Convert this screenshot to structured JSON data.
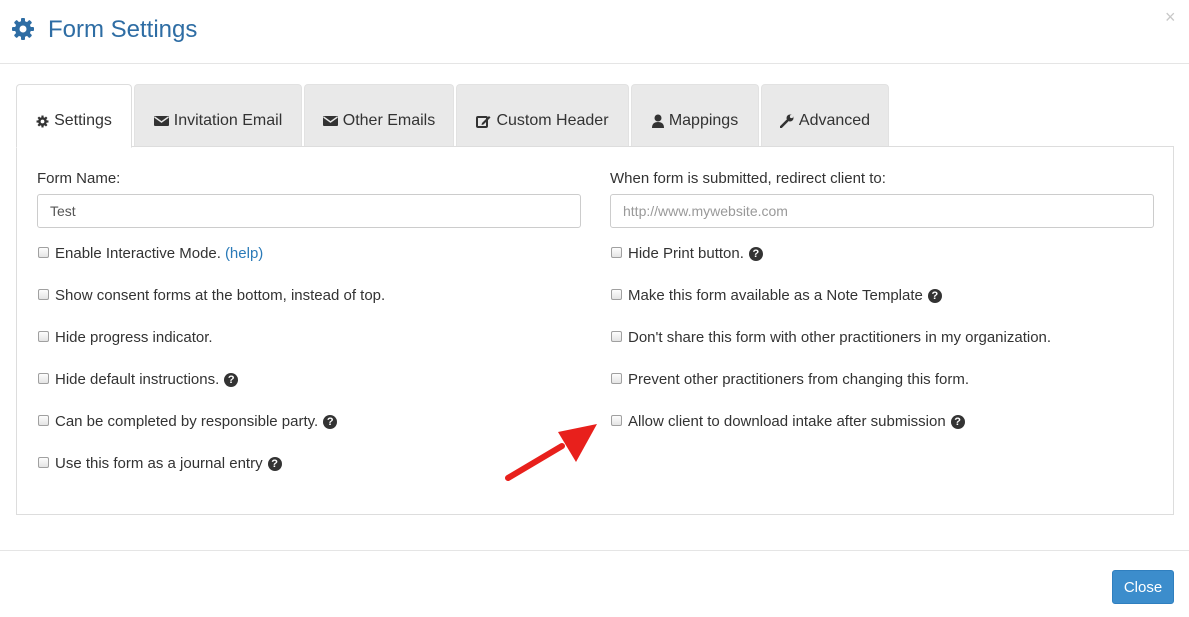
{
  "header": {
    "title": "Form Settings",
    "title_icon": "gear-icon",
    "close_glyph": "×",
    "accent_color": "#2e6da4"
  },
  "tabs": [
    {
      "label": "Settings",
      "icon": "gear-icon",
      "active": true
    },
    {
      "label": "Invitation Email",
      "icon": "envelope-icon",
      "active": false
    },
    {
      "label": "Other Emails",
      "icon": "envelope-icon",
      "active": false
    },
    {
      "label": "Custom Header",
      "icon": "edit-icon",
      "active": false
    },
    {
      "label": "Mappings",
      "icon": "user-icon",
      "active": false
    },
    {
      "label": "Advanced",
      "icon": "wrench-icon",
      "active": false
    }
  ],
  "form": {
    "form_name_label": "Form Name:",
    "form_name_value": "Test",
    "redirect_label": "When form is submitted, redirect client to:",
    "redirect_placeholder": "http://www.mywebsite.com"
  },
  "left_options": [
    {
      "label": "Enable Interactive Mode.",
      "link": "(help)",
      "help_icon": false
    },
    {
      "label": "Show consent forms at the bottom, instead of top.",
      "help_icon": false
    },
    {
      "label": "Hide progress indicator.",
      "help_icon": false
    },
    {
      "label": "Hide default instructions.",
      "help_icon": true
    },
    {
      "label": "Can be completed by responsible party.",
      "help_icon": true
    },
    {
      "label": "Use this form as a journal entry",
      "help_icon": true
    }
  ],
  "right_options": [
    {
      "label": "Hide Print button.",
      "help_icon": true
    },
    {
      "label": "Make this form available as a Note Template",
      "help_icon": true
    },
    {
      "label": "Don't share this form with other practitioners in my organization.",
      "help_icon": false
    },
    {
      "label": "Prevent other practitioners from changing this form.",
      "help_icon": false
    },
    {
      "label": "Allow client to download intake after submission",
      "help_icon": true
    }
  ],
  "help_glyph": "?",
  "annotation": {
    "arrow_color": "#e8201c",
    "points_to": "Allow client to download intake after submission"
  },
  "footer": {
    "close_label": "Close",
    "button_color": "#3c8dcc"
  }
}
